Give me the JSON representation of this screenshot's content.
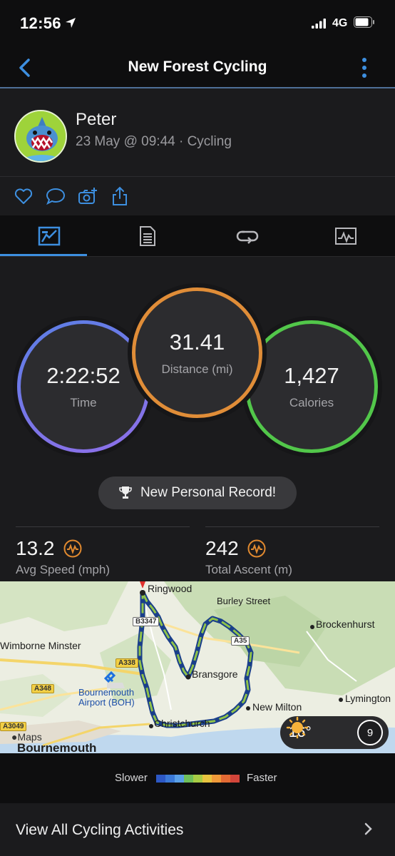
{
  "status": {
    "time": "12:56",
    "network": "4G"
  },
  "nav": {
    "title": "New Forest Cycling"
  },
  "profile": {
    "name": "Peter",
    "meta": "23 May @ 09:44 · Cycling"
  },
  "tabs": [
    "summary",
    "details",
    "laps",
    "charts"
  ],
  "stats": {
    "time": {
      "value": "2:22:52",
      "label": "Time"
    },
    "distance": {
      "value": "31.41",
      "label": "Distance (mi)"
    },
    "calories": {
      "value": "1,427",
      "label": "Calories"
    }
  },
  "personal_record": "New Personal Record!",
  "metrics": {
    "avg_speed": {
      "value": "13.2",
      "unit": "Avg Speed (mph)"
    },
    "total_ascent": {
      "value": "242",
      "unit": "Total Ascent (m)"
    }
  },
  "map": {
    "places": {
      "ringwood": "Ringwood",
      "burley": "Burley Street",
      "brockenhurst": "Brockenhurst",
      "wimborne": "Wimborne Minster",
      "bransgore": "Bransgore",
      "airport": "Bournemouth\nAirport (BOH)",
      "new_milton": "New Milton",
      "lymington": "Lymington",
      "christchurch": "Christchurch",
      "bournemouth": "Bournemouth"
    },
    "roads": {
      "b3347": "B3347",
      "a35": "A35",
      "a338": "A338",
      "a348": "A348",
      "a3049": "A3049"
    },
    "attribution": "Maps",
    "weather": {
      "temp": "16°",
      "aqi": "9"
    }
  },
  "legend": {
    "slower": "Slower",
    "faster": "Faster",
    "colors": [
      "#2d58c5",
      "#3b79d8",
      "#5aa0e8",
      "#6fbf5a",
      "#a8cc45",
      "#e8c440",
      "#ef9a3a",
      "#e36a34",
      "#d2453a"
    ]
  },
  "footer": {
    "view_all": "View All Cycling Activities"
  }
}
